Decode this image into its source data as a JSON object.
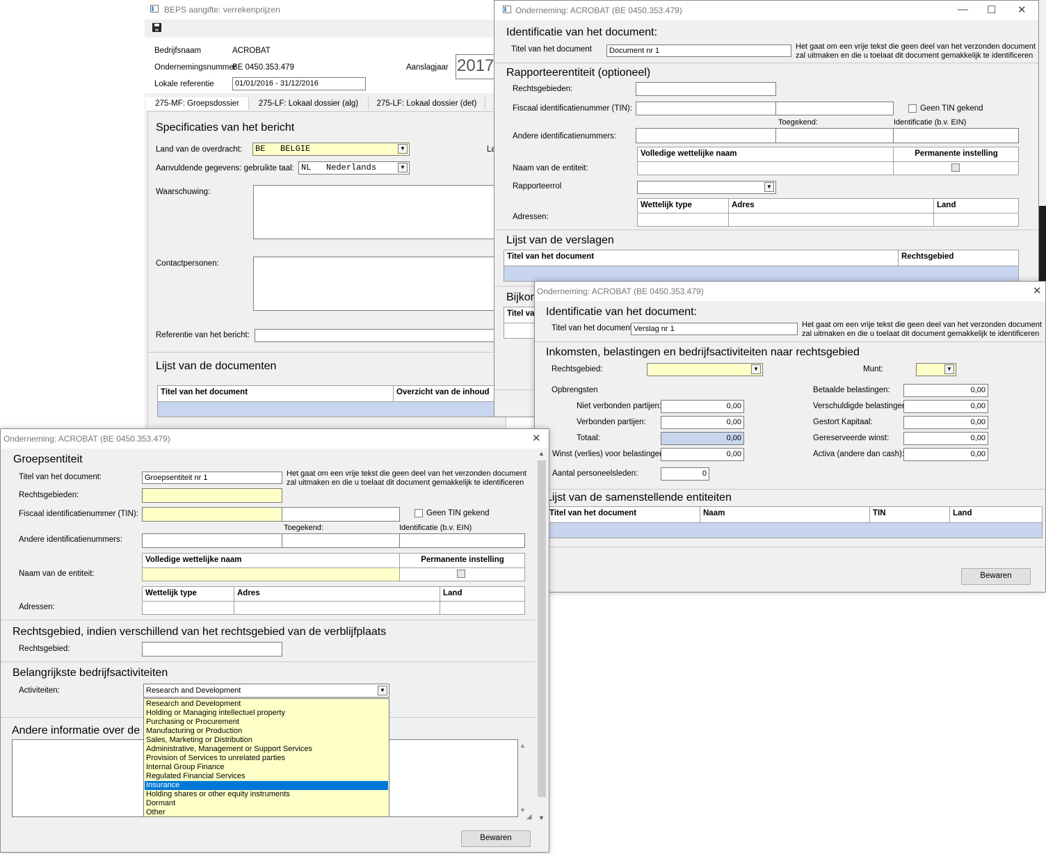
{
  "beps": {
    "title": "BEPS aangifte: verrekenprijzen",
    "labels": {
      "company": "Bedrijfsnaam",
      "company_no": "Ondernemingsnummer",
      "local_ref": "Lokale referentie",
      "tax_year": "Aanslagjaar"
    },
    "company": "ACROBAT",
    "company_no": "BE 0450.353.479",
    "local_ref": "01/01/2016 - 31/12/2016",
    "tax_year": "2017",
    "tabs": [
      "275-MF: Groepsdossier",
      "275-LF: Lokaal dossier (alg)",
      "275-LF: Lokaal dossier (det)"
    ],
    "spec_heading": "Specificaties van het bericht",
    "country_label": "Land van de overdracht:",
    "country_code": "BE",
    "country_name": "BELGIE",
    "partial_label": "La",
    "lang_label": "Aanvuldende gegevens: gebruikte taal:",
    "lang_code": "NL",
    "lang_name": "Nederlands",
    "warning_label": "Waarschuwing:",
    "contacts_label": "Contactpersonen:",
    "msgref_label": "Referentie van het bericht:",
    "docs_heading": "Lijst van de documenten",
    "docs_cols": [
      "Titel van het document",
      "Overzicht van de inhoud"
    ]
  },
  "w1": {
    "title": "Onderneming: ACROBAT (BE 0450.353.479)",
    "id_heading": "Identificatie van het document:",
    "doc_title_label": "Titel van het document",
    "doc_title": "Document nr 1",
    "help1": "Het gaat om een vrije tekst die geen deel van het verzonden document",
    "help2": "zal uitmaken en die u toelaat dit document gemakkelijk te identificeren",
    "rep_heading": "Rapporteerentiteit (optioneel)",
    "jur_label": "Rechtsgebieden:",
    "tin_label": "Fiscaal identificatienummer (TIN):",
    "no_tin": "Geen TIN gekend",
    "granted": "Toegekend:",
    "ident": "Identificatie (b.v. EIN)",
    "other_ids": "Andere identificatienummers:",
    "col_full_name": "Volledige wettelijke naam",
    "col_perm": "Permanente instelling",
    "entity_name": "Naam van de entiteit:",
    "role": "Rapporteerrol",
    "addresses": "Adressen:",
    "addr_cols": [
      "Wettelijk type",
      "Adres",
      "Land"
    ],
    "reports_heading": "Lijst van de verslagen",
    "reports_cols": [
      "Titel van het document",
      "Rechtsgebied"
    ],
    "bijko": "Bijkor",
    "titel_va": "Titel va"
  },
  "w2": {
    "title": "Onderneming: ACROBAT (BE 0450.353.479)",
    "id_heading": "Identificatie van het document:",
    "doc_title_label": "Titel van het document",
    "doc_title": "Verslag nr 1",
    "help1": "Het gaat om een vrije tekst die geen deel van het verzonden document",
    "help2": "zal uitmaken en die u toelaat dit document gemakkelijk te identificeren",
    "inc_heading": "Inkomsten, belastingen en bedrijfsactiviteiten naar rechtsgebied",
    "jur_label": "Rechtsgebied:",
    "currency_label": "Munt:",
    "revenues": "Opbrengsten",
    "left_fields": [
      {
        "label": "Niet verbonden partijen:",
        "value": "0,00"
      },
      {
        "label": "Verbonden partijen:",
        "value": "0,00"
      },
      {
        "label": "Totaal:",
        "value": "0,00"
      },
      {
        "label": "Winst (verlies) voor belastingen:",
        "value": "0,00"
      }
    ],
    "right_fields": [
      {
        "label": "Betaalde belastingen:",
        "value": "0,00"
      },
      {
        "label": "Verschuldigde belastingen:",
        "value": "0,00"
      },
      {
        "label": "Gestort Kapitaal:",
        "value": "0,00"
      },
      {
        "label": "Gereserveerde winst:",
        "value": "0,00"
      },
      {
        "label": "Activa (andere dan cash):",
        "value": "0,00"
      }
    ],
    "employees_label": "Aantal personeelsleden:",
    "employees": "0",
    "entities_heading": "Lijst van de samenstellende entiteiten",
    "entities_cols": [
      "Titel van het document",
      "Naam",
      "TIN",
      "Land"
    ],
    "save": "Bewaren"
  },
  "w3": {
    "title": "Onderneming: ACROBAT (BE 0450.353.479)",
    "group_heading": "Groepsentiteit",
    "doc_title_label": "Titel van het document:",
    "doc_title": "Groepsentiteit nr 1",
    "help1": "Het gaat om een vrije tekst die geen deel van het verzonden document",
    "help2": "zal uitmaken en die u toelaat dit document gemakkelijk te identificeren",
    "jur_label": "Rechtsgebieden:",
    "tin_label": "Fiscaal identificatienummer (TIN):",
    "no_tin": "Geen TIN gekend",
    "granted": "Toegekend:",
    "ident": "Identificatie (b.v. EIN)",
    "other_ids": "Andere identificatienummers:",
    "col_full_name": "Volledige wettelijke naam",
    "col_perm": "Permanente instelling",
    "entity_name": "Naam van de entiteit:",
    "addresses": "Adressen:",
    "addr_cols": [
      "Wettelijk type",
      "Adres",
      "Land"
    ],
    "jur2_heading": "Rechtsgebied, indien verschillend van het rechtsgebied van de verblijfplaats",
    "jur2_label": "Rechtsgebied:",
    "act_heading": "Belangrijkste bedrijfsactiviteiten",
    "act_label": "Activiteiten:",
    "act_value": "Research and Development",
    "activities": [
      "Research and Development",
      "Holding or Managing intellectuel property",
      "Purchasing or Procurement",
      "Manufacturing or Production",
      "Sales, Marketing or Distribution",
      "Administrative, Management or Support Services",
      "Provision of Services to unrelated parties",
      "Internal Group Finance",
      "Regulated Financial Services",
      "Insurance",
      "Holding shares or other equity instruments",
      "Dormant",
      "Other"
    ],
    "selected_index": 9,
    "other_info": "Andere informatie over de",
    "save": "Bewaren"
  }
}
